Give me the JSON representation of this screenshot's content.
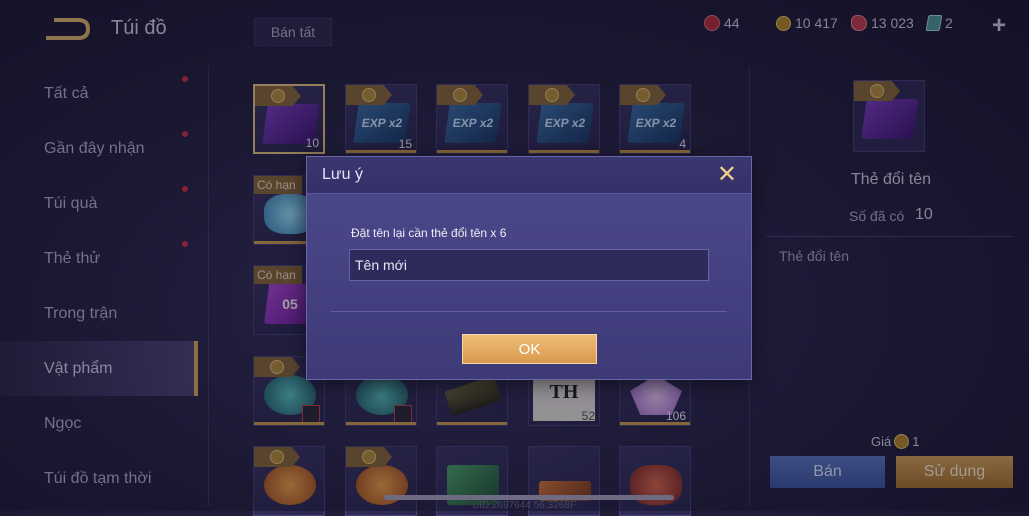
{
  "header": {
    "title": "Túi đồ",
    "sell_all": "Bán tất"
  },
  "currencies": [
    {
      "icon": "red-coin-icon",
      "value": "44"
    },
    {
      "icon": "gold-coin-icon",
      "value": "10 417"
    },
    {
      "icon": "ruby-icon",
      "value": "13 023"
    },
    {
      "icon": "card-icon",
      "value": "2"
    }
  ],
  "plus": "+",
  "sidebar": {
    "items": [
      {
        "label": "Tất cả"
      },
      {
        "label": "Gần đây nhận"
      },
      {
        "label": "Túi quà"
      },
      {
        "label": "Thẻ thử"
      },
      {
        "label": "Trong trận"
      },
      {
        "label": "Vật phẩm"
      },
      {
        "label": "Ngọc"
      },
      {
        "label": "Túi đồ tạm thời"
      }
    ]
  },
  "grid": {
    "tag_limited": "Có hạn",
    "exp_label": "EXP x2",
    "ticket_label": "05",
    "book_label": "TH",
    "qty": {
      "purple_card": "10",
      "exp1": "15",
      "exp4": "4",
      "book": "52",
      "gem": "106"
    }
  },
  "detail": {
    "name": "Thẻ đổi tên",
    "owned_label": "Số đã có",
    "owned_value": "10",
    "description": "Thẻ đổi tên",
    "price_label": "Giá",
    "price_value": "1",
    "sell": "Bán",
    "use": "Sử dụng"
  },
  "dialog": {
    "title": "Lưu ý",
    "close": "✕",
    "message": "Đặt tên lại cần thẻ đổi tên x 6",
    "input_placeholder": "Tên mới",
    "ok": "OK"
  },
  "footer": {
    "uid": "UID:2697644 56:3268F"
  }
}
